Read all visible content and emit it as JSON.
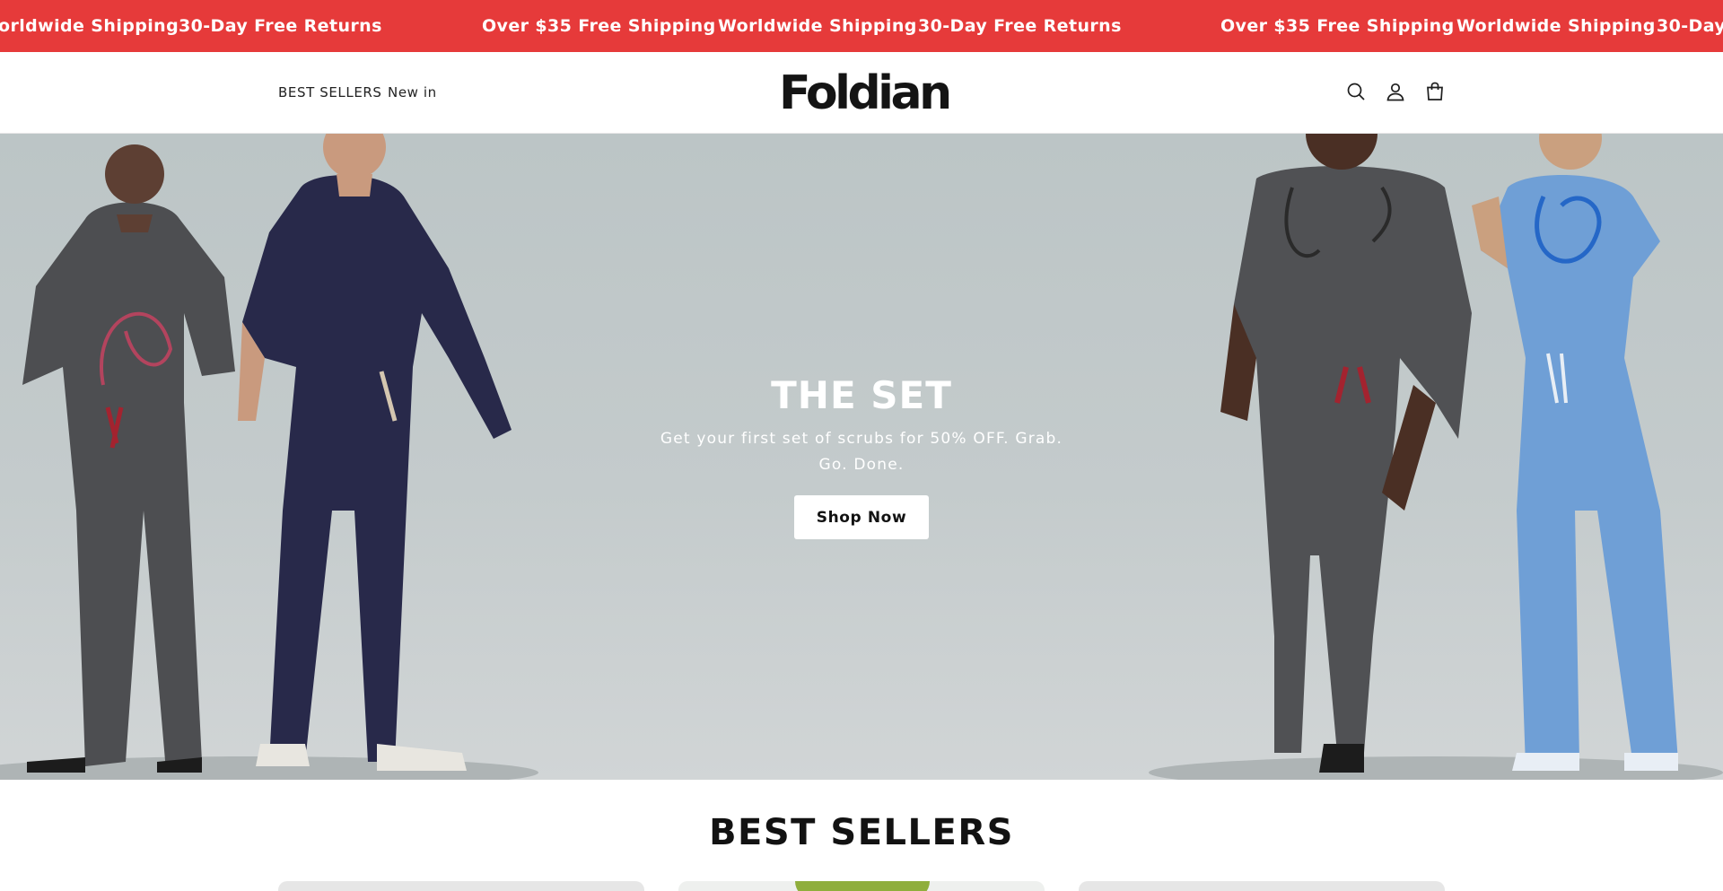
{
  "announcement": {
    "messages": [
      "orldwide Shipping",
      "30-Day Free Returns",
      "Over $35 Free Shipping",
      "Worldwide Shipping",
      "30-Day Free Returns",
      "Over $35 Free Shipping",
      "Worldwide Shipping",
      "30-Day"
    ],
    "background": "#e63a3a"
  },
  "header": {
    "nav": [
      "BEST SELLERS",
      "New in"
    ],
    "logo": "Foldian",
    "icons": [
      "search-icon",
      "account-icon",
      "cart-icon"
    ]
  },
  "hero": {
    "title": "THE SET",
    "subtitle": "Get your first set of scrubs for 50% OFF. Grab. Go. Done.",
    "button": "Shop Now"
  },
  "best_sellers": {
    "title": "BEST SELLERS"
  }
}
